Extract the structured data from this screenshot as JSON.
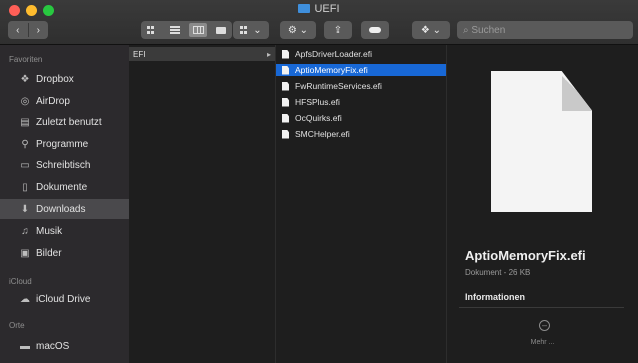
{
  "window": {
    "title": "UEFI"
  },
  "toolbar": {
    "back": "‹",
    "forward": "›",
    "share_glyph": "⇪",
    "search_placeholder": "Suchen"
  },
  "sidebar": {
    "favorites_heading": "Favoriten",
    "icloud_heading": "iCloud",
    "places_heading": "Orte",
    "items": [
      {
        "label": "Dropbox",
        "icon": "dropbox-icon"
      },
      {
        "label": "AirDrop",
        "icon": "airdrop-icon"
      },
      {
        "label": "Zuletzt benutzt",
        "icon": "recents-icon"
      },
      {
        "label": "Programme",
        "icon": "applications-icon"
      },
      {
        "label": "Schreibtisch",
        "icon": "desktop-icon"
      },
      {
        "label": "Dokumente",
        "icon": "documents-icon"
      },
      {
        "label": "Downloads",
        "icon": "downloads-icon"
      },
      {
        "label": "Musik",
        "icon": "music-icon"
      },
      {
        "label": "Bilder",
        "icon": "pictures-icon"
      }
    ],
    "icloud_items": [
      {
        "label": "iCloud Drive",
        "icon": "cloud-icon"
      }
    ],
    "places_items": [
      {
        "label": "macOS",
        "icon": "disk-icon"
      }
    ]
  },
  "column1": {
    "folder": "EFI"
  },
  "column2": {
    "files": [
      "ApfsDriverLoader.efi",
      "AptioMemoryFix.efi",
      "FwRuntimeServices.efi",
      "HFSPlus.efi",
      "OcQuirks.efi",
      "SMCHelper.efi"
    ],
    "selected_index": 1
  },
  "preview": {
    "name": "AptioMemoryFix.efi",
    "meta": "Dokument - 26 KB",
    "info_heading": "Informationen",
    "more_label": "Mehr ..."
  },
  "colors": {
    "selection": "#1868d6",
    "sidebar_selected": "#4a494c"
  }
}
